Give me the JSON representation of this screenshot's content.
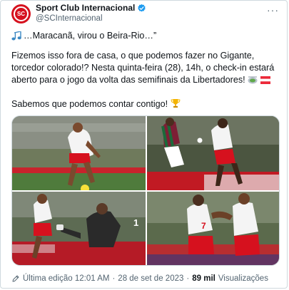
{
  "author": {
    "display_name": "Sport Club Internacional",
    "handle": "@SCInternacional",
    "avatar_text": "SC",
    "avatar_color": "#d6111e",
    "verified_color": "#1d9bf0"
  },
  "more_icon": "···",
  "tweet": {
    "line1": "…Maracanã, virou o Beira-Rio…”",
    "line1_emoji": "music-notes",
    "para2": "Fizemos isso fora de casa, o que podemos fazer no Gigante, torcedor colorado!? Nesta quinta-feira (28), 14h, o check-in estará aberto para o jogo da volta das semifinais da Libertadores!",
    "para2_emojis": [
      "stadium",
      "flag-austria"
    ],
    "para3": "Sabemos que podemos contar contigo!",
    "para3_emoji": "trophy"
  },
  "media": {
    "photos": [
      {
        "description": "player-with-ball"
      },
      {
        "description": "player-tackle"
      },
      {
        "description": "goalkeeper-dive"
      },
      {
        "description": "players-celebrate"
      }
    ],
    "shirt_numbers": [
      "7",
      "1"
    ]
  },
  "footer": {
    "edited_label": "Última edição 12:01 AM",
    "separator": "·",
    "date": "28 de set de 2023",
    "views_count": "89 mil",
    "views_label": "Visualizações"
  },
  "colors": {
    "text": "#0f1419",
    "secondary": "#536471",
    "border": "#cfd9de",
    "club_red": "#d6111e"
  }
}
